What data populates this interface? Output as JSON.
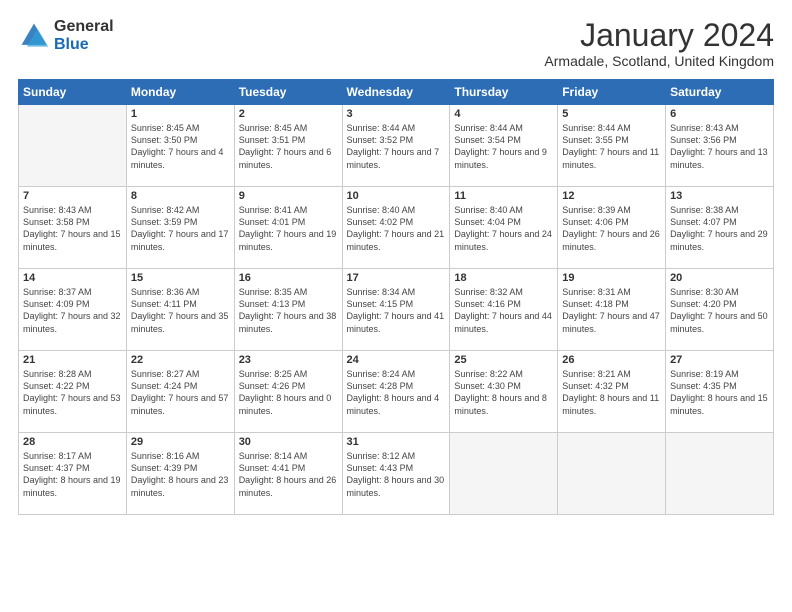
{
  "logo": {
    "general": "General",
    "blue": "Blue"
  },
  "title": "January 2024",
  "location": "Armadale, Scotland, United Kingdom",
  "days_header": [
    "Sunday",
    "Monday",
    "Tuesday",
    "Wednesday",
    "Thursday",
    "Friday",
    "Saturday"
  ],
  "weeks": [
    [
      {
        "day": "",
        "sunrise": "",
        "sunset": "",
        "daylight": ""
      },
      {
        "day": "1",
        "sunrise": "Sunrise: 8:45 AM",
        "sunset": "Sunset: 3:50 PM",
        "daylight": "Daylight: 7 hours and 4 minutes."
      },
      {
        "day": "2",
        "sunrise": "Sunrise: 8:45 AM",
        "sunset": "Sunset: 3:51 PM",
        "daylight": "Daylight: 7 hours and 6 minutes."
      },
      {
        "day": "3",
        "sunrise": "Sunrise: 8:44 AM",
        "sunset": "Sunset: 3:52 PM",
        "daylight": "Daylight: 7 hours and 7 minutes."
      },
      {
        "day": "4",
        "sunrise": "Sunrise: 8:44 AM",
        "sunset": "Sunset: 3:54 PM",
        "daylight": "Daylight: 7 hours and 9 minutes."
      },
      {
        "day": "5",
        "sunrise": "Sunrise: 8:44 AM",
        "sunset": "Sunset: 3:55 PM",
        "daylight": "Daylight: 7 hours and 11 minutes."
      },
      {
        "day": "6",
        "sunrise": "Sunrise: 8:43 AM",
        "sunset": "Sunset: 3:56 PM",
        "daylight": "Daylight: 7 hours and 13 minutes."
      }
    ],
    [
      {
        "day": "7",
        "sunrise": "Sunrise: 8:43 AM",
        "sunset": "Sunset: 3:58 PM",
        "daylight": "Daylight: 7 hours and 15 minutes."
      },
      {
        "day": "8",
        "sunrise": "Sunrise: 8:42 AM",
        "sunset": "Sunset: 3:59 PM",
        "daylight": "Daylight: 7 hours and 17 minutes."
      },
      {
        "day": "9",
        "sunrise": "Sunrise: 8:41 AM",
        "sunset": "Sunset: 4:01 PM",
        "daylight": "Daylight: 7 hours and 19 minutes."
      },
      {
        "day": "10",
        "sunrise": "Sunrise: 8:40 AM",
        "sunset": "Sunset: 4:02 PM",
        "daylight": "Daylight: 7 hours and 21 minutes."
      },
      {
        "day": "11",
        "sunrise": "Sunrise: 8:40 AM",
        "sunset": "Sunset: 4:04 PM",
        "daylight": "Daylight: 7 hours and 24 minutes."
      },
      {
        "day": "12",
        "sunrise": "Sunrise: 8:39 AM",
        "sunset": "Sunset: 4:06 PM",
        "daylight": "Daylight: 7 hours and 26 minutes."
      },
      {
        "day": "13",
        "sunrise": "Sunrise: 8:38 AM",
        "sunset": "Sunset: 4:07 PM",
        "daylight": "Daylight: 7 hours and 29 minutes."
      }
    ],
    [
      {
        "day": "14",
        "sunrise": "Sunrise: 8:37 AM",
        "sunset": "Sunset: 4:09 PM",
        "daylight": "Daylight: 7 hours and 32 minutes."
      },
      {
        "day": "15",
        "sunrise": "Sunrise: 8:36 AM",
        "sunset": "Sunset: 4:11 PM",
        "daylight": "Daylight: 7 hours and 35 minutes."
      },
      {
        "day": "16",
        "sunrise": "Sunrise: 8:35 AM",
        "sunset": "Sunset: 4:13 PM",
        "daylight": "Daylight: 7 hours and 38 minutes."
      },
      {
        "day": "17",
        "sunrise": "Sunrise: 8:34 AM",
        "sunset": "Sunset: 4:15 PM",
        "daylight": "Daylight: 7 hours and 41 minutes."
      },
      {
        "day": "18",
        "sunrise": "Sunrise: 8:32 AM",
        "sunset": "Sunset: 4:16 PM",
        "daylight": "Daylight: 7 hours and 44 minutes."
      },
      {
        "day": "19",
        "sunrise": "Sunrise: 8:31 AM",
        "sunset": "Sunset: 4:18 PM",
        "daylight": "Daylight: 7 hours and 47 minutes."
      },
      {
        "day": "20",
        "sunrise": "Sunrise: 8:30 AM",
        "sunset": "Sunset: 4:20 PM",
        "daylight": "Daylight: 7 hours and 50 minutes."
      }
    ],
    [
      {
        "day": "21",
        "sunrise": "Sunrise: 8:28 AM",
        "sunset": "Sunset: 4:22 PM",
        "daylight": "Daylight: 7 hours and 53 minutes."
      },
      {
        "day": "22",
        "sunrise": "Sunrise: 8:27 AM",
        "sunset": "Sunset: 4:24 PM",
        "daylight": "Daylight: 7 hours and 57 minutes."
      },
      {
        "day": "23",
        "sunrise": "Sunrise: 8:25 AM",
        "sunset": "Sunset: 4:26 PM",
        "daylight": "Daylight: 8 hours and 0 minutes."
      },
      {
        "day": "24",
        "sunrise": "Sunrise: 8:24 AM",
        "sunset": "Sunset: 4:28 PM",
        "daylight": "Daylight: 8 hours and 4 minutes."
      },
      {
        "day": "25",
        "sunrise": "Sunrise: 8:22 AM",
        "sunset": "Sunset: 4:30 PM",
        "daylight": "Daylight: 8 hours and 8 minutes."
      },
      {
        "day": "26",
        "sunrise": "Sunrise: 8:21 AM",
        "sunset": "Sunset: 4:32 PM",
        "daylight": "Daylight: 8 hours and 11 minutes."
      },
      {
        "day": "27",
        "sunrise": "Sunrise: 8:19 AM",
        "sunset": "Sunset: 4:35 PM",
        "daylight": "Daylight: 8 hours and 15 minutes."
      }
    ],
    [
      {
        "day": "28",
        "sunrise": "Sunrise: 8:17 AM",
        "sunset": "Sunset: 4:37 PM",
        "daylight": "Daylight: 8 hours and 19 minutes."
      },
      {
        "day": "29",
        "sunrise": "Sunrise: 8:16 AM",
        "sunset": "Sunset: 4:39 PM",
        "daylight": "Daylight: 8 hours and 23 minutes."
      },
      {
        "day": "30",
        "sunrise": "Sunrise: 8:14 AM",
        "sunset": "Sunset: 4:41 PM",
        "daylight": "Daylight: 8 hours and 26 minutes."
      },
      {
        "day": "31",
        "sunrise": "Sunrise: 8:12 AM",
        "sunset": "Sunset: 4:43 PM",
        "daylight": "Daylight: 8 hours and 30 minutes."
      },
      {
        "day": "",
        "sunrise": "",
        "sunset": "",
        "daylight": ""
      },
      {
        "day": "",
        "sunrise": "",
        "sunset": "",
        "daylight": ""
      },
      {
        "day": "",
        "sunrise": "",
        "sunset": "",
        "daylight": ""
      }
    ]
  ]
}
